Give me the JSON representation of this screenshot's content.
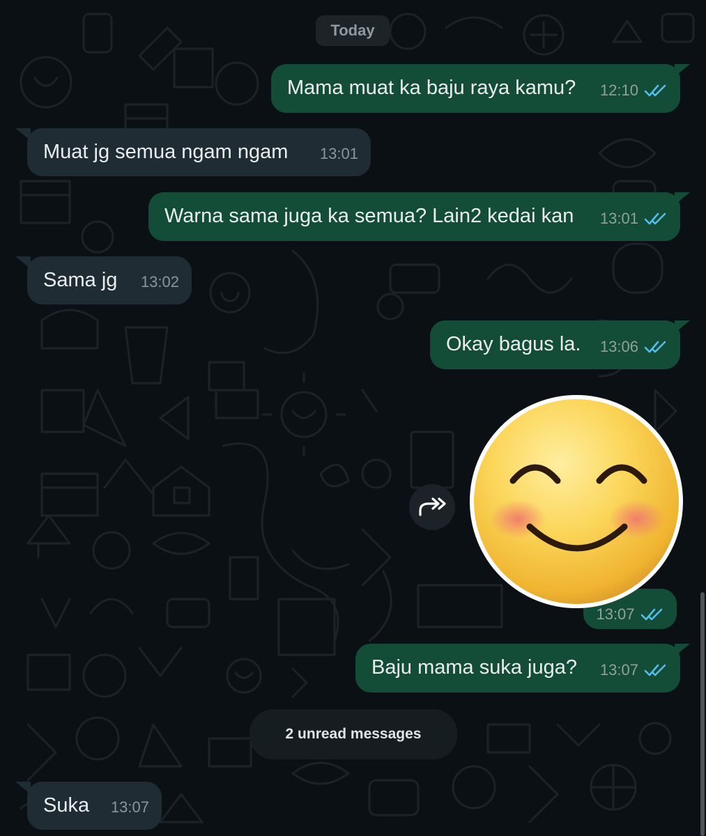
{
  "chat": {
    "date_label": "Today",
    "unread_label": "2 unread messages",
    "sticker": {
      "emoji": "smiling-face-with-smiling-eyes",
      "time": "13:07",
      "status": "read"
    },
    "messages": [
      {
        "direction": "out",
        "text": "Mama muat ka baju raya kamu?",
        "time": "12:10",
        "status": "read"
      },
      {
        "direction": "in",
        "text": "Muat jg semua ngam ngam",
        "time": "13:01"
      },
      {
        "direction": "out",
        "text": "Warna sama juga ka semua? Lain2 kedai kan",
        "time": "13:01",
        "status": "read"
      },
      {
        "direction": "in",
        "text": "Sama jg",
        "time": "13:02"
      },
      {
        "direction": "out",
        "text": "Okay bagus la.",
        "time": "13:06",
        "status": "read"
      },
      {
        "direction": "out",
        "text": "Baju mama suka juga?",
        "time": "13:07",
        "status": "read"
      },
      {
        "direction": "in",
        "text": "Suka",
        "time": "13:07"
      }
    ]
  },
  "icons": {
    "read_tick": "double-check-icon",
    "forward": "forward-icon"
  },
  "colors": {
    "background": "#0b1014",
    "outgoing_bubble": "#144d37",
    "incoming_bubble": "#1f2c33",
    "read_tick": "#53bdeb"
  }
}
